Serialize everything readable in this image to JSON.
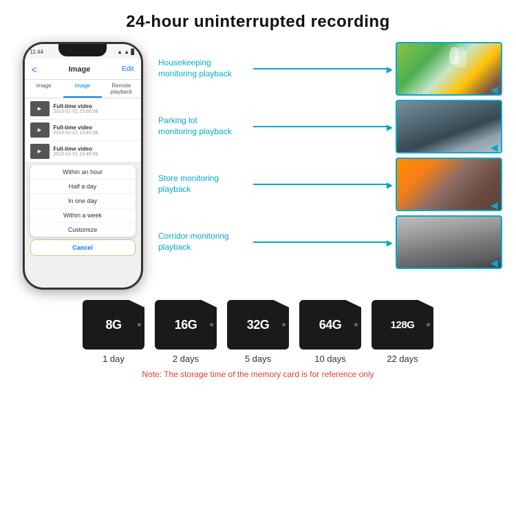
{
  "header": {
    "title": "24-hour uninterrupted recording"
  },
  "phone": {
    "status_time": "11:44",
    "nav_title": "Image",
    "nav_edit": "Edit",
    "nav_back": "<",
    "tabs": [
      "image",
      "Image",
      "Remote playback"
    ],
    "videos": [
      {
        "title": "Full-time video",
        "time": "2019-01-01 15:68:08"
      },
      {
        "title": "Full-time video",
        "time": "2019-01-01 13:45:08"
      },
      {
        "title": "Full-time video",
        "time": "2019-01-01 13:40:08"
      }
    ],
    "dropdown_items": [
      "Within an hour",
      "Half a day",
      "In one day",
      "Within a week",
      "Customize"
    ],
    "cancel_label": "Cancel"
  },
  "monitoring": [
    {
      "label": "Housekeeping\nmonitoring playback",
      "photo_class": "photo-housekeeping"
    },
    {
      "label": "Parking lot\nmonitoring playback",
      "photo_class": "photo-parking"
    },
    {
      "label": "Store monitoring\nplayback",
      "photo_class": "photo-store"
    },
    {
      "label": "Corridor monitoring\nplayback",
      "photo_class": "photo-corridor"
    }
  ],
  "storage_cards": [
    {
      "size": "8G",
      "days": "1 day"
    },
    {
      "size": "16G",
      "days": "2 days"
    },
    {
      "size": "32G",
      "days": "5 days"
    },
    {
      "size": "64G",
      "days": "10 days"
    },
    {
      "size": "128G",
      "days": "22 days"
    }
  ],
  "note": "Note: The storage time of the memory card is for reference only"
}
